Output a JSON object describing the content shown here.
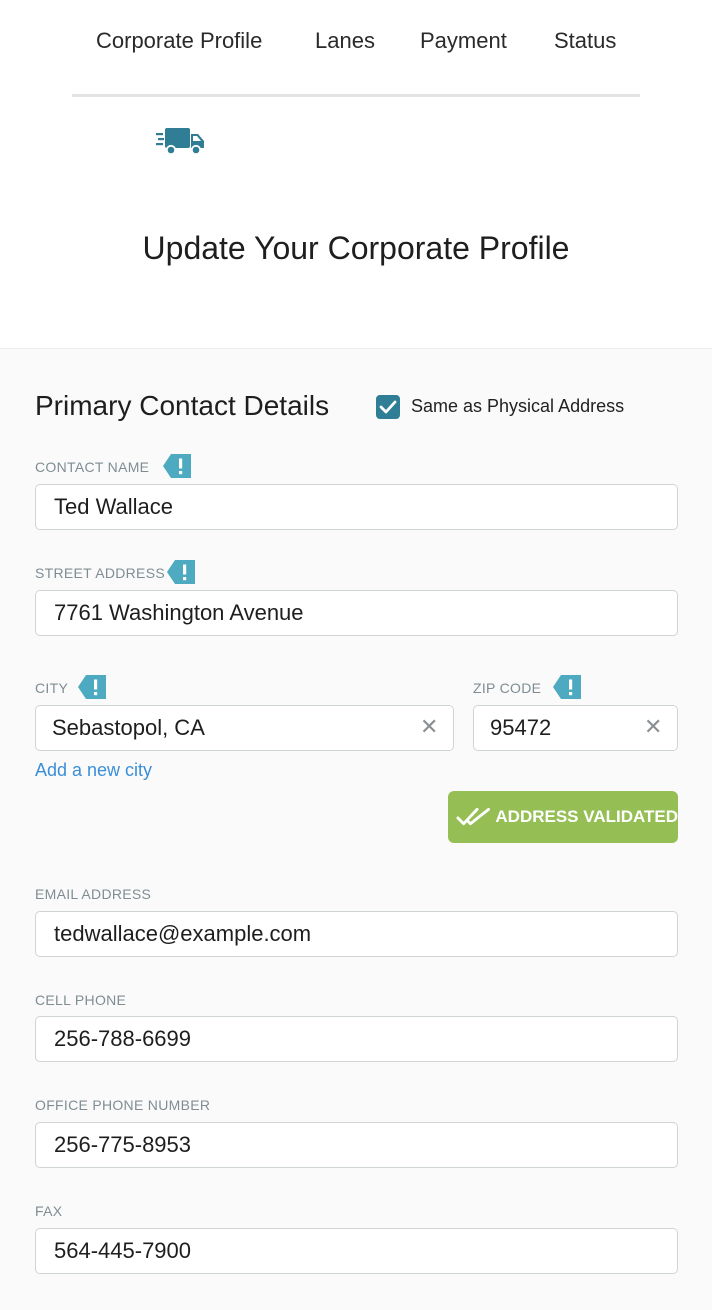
{
  "tabs": [
    "Corporate Profile",
    "Lanes",
    "Payment",
    "Status"
  ],
  "page_title": "Update Your Corporate Profile",
  "section": {
    "title": "Primary Contact Details",
    "same_as_physical": {
      "label": "Same as Physical Address",
      "checked": true
    }
  },
  "fields": {
    "contact_name": {
      "label": "CONTACT NAME",
      "value": "Ted Wallace",
      "required": true
    },
    "street_address": {
      "label": "STREET ADDRESS",
      "value": "7761 Washington Avenue",
      "required": true
    },
    "city": {
      "label": "CITY",
      "value": "Sebastopol, CA",
      "required": true
    },
    "zip_code": {
      "label": "ZIP CODE",
      "value": "95472",
      "required": true
    },
    "email": {
      "label": "EMAIL ADDRESS",
      "value": "tedwallace@example.com"
    },
    "cell_phone": {
      "label": "CELL PHONE",
      "value": "256-788-6699"
    },
    "office_phone": {
      "label": "OFFICE PHONE NUMBER",
      "value": "256-775-8953"
    },
    "fax": {
      "label": "FAX",
      "value": "564-445-7900"
    }
  },
  "add_city_link": "Add a new city",
  "validated_button": "ADDRESS VALIDATED",
  "icons": {
    "logo": "truck-icon",
    "required": "exclamation-tag-icon",
    "clear": "close-icon",
    "check": "checkmark-icon",
    "validated": "double-check-icon"
  },
  "colors": {
    "primary": "#2f7e95",
    "tag": "#4eaac0",
    "success": "#95bf55",
    "link": "#3a8fd8"
  }
}
